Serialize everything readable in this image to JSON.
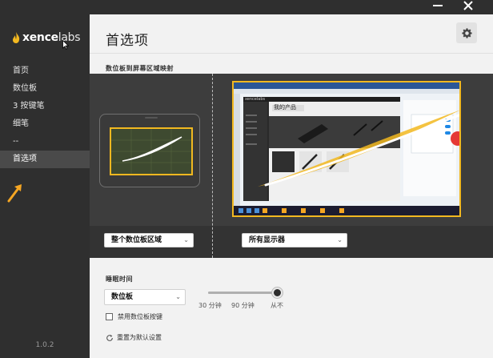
{
  "window": {
    "minimize_icon": "minus-icon",
    "close_icon": "x-icon"
  },
  "brand": {
    "name_bold": "xence",
    "name_light": "labs",
    "accent": "#f2b820"
  },
  "sidebar": {
    "items": [
      {
        "label": "首页"
      },
      {
        "label": "数位板"
      },
      {
        "label": "3 按键笔"
      },
      {
        "label": "细笔"
      },
      {
        "label": "--"
      },
      {
        "label": "首选项",
        "active": true
      }
    ],
    "version": "1.0.2"
  },
  "main": {
    "title": "首选项",
    "settings_icon": "gear-icon",
    "mapping": {
      "label": "数位板到屏幕区域映射",
      "tablet_select": "整个数位板区域",
      "display_select": "所有显示器",
      "screen_content": {
        "window_title": "我的产品",
        "window_brand": "xencelabs"
      }
    },
    "sleep": {
      "label": "睡眠时间",
      "device_select": "数位板",
      "slider_ticks": [
        "30 分钟",
        "90 分钟",
        "从不"
      ],
      "slider_position": 1.0
    },
    "disable_buttons": {
      "label": "禁用数位板按键",
      "checked": false
    },
    "reset": {
      "label": "重置为默认设置"
    }
  }
}
